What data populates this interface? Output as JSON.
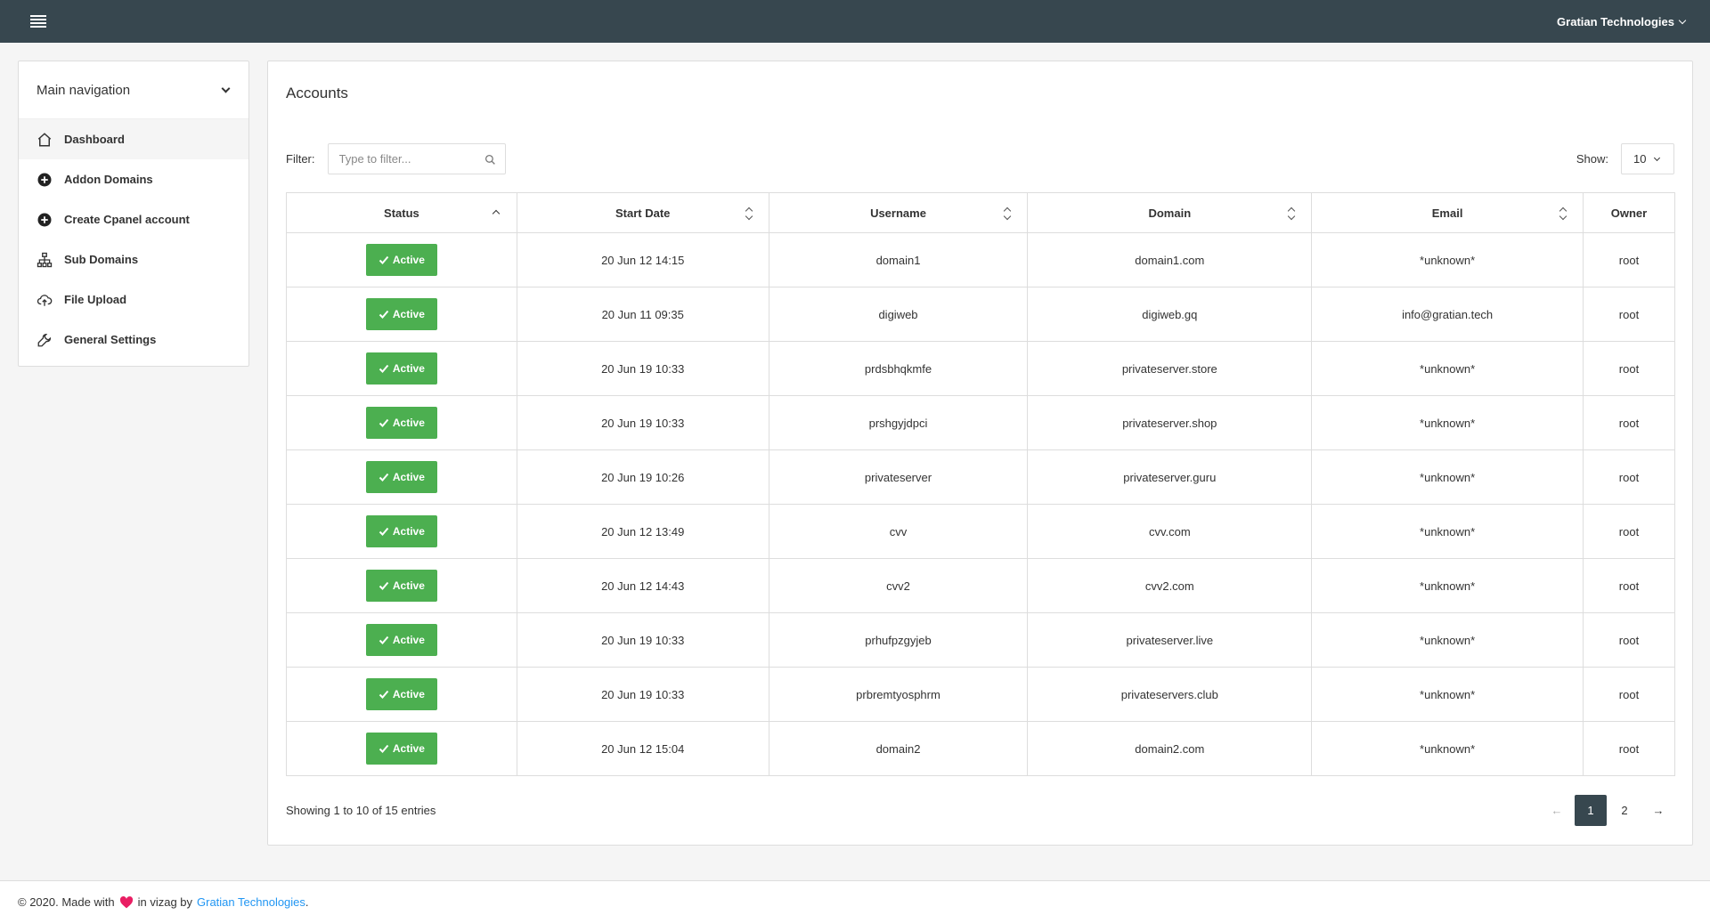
{
  "header": {
    "org": "Gratian Technologies"
  },
  "sidebar": {
    "title": "Main navigation",
    "items": [
      {
        "label": "Dashboard",
        "icon": "home-icon"
      },
      {
        "label": "Addon Domains",
        "icon": "plus-circle-icon"
      },
      {
        "label": "Create Cpanel account",
        "icon": "plus-circle-icon"
      },
      {
        "label": "Sub Domains",
        "icon": "sitemap-icon"
      },
      {
        "label": "File Upload",
        "icon": "cloud-upload-icon"
      },
      {
        "label": "General Settings",
        "icon": "wrench-icon"
      }
    ]
  },
  "main": {
    "title": "Accounts",
    "filter_label": "Filter:",
    "filter_placeholder": "Type to filter...",
    "show_label": "Show:",
    "show_value": "10",
    "columns": [
      "Status",
      "Start Date",
      "Username",
      "Domain",
      "Email",
      "Owner"
    ],
    "rows": [
      {
        "status": "Active",
        "start": "20 Jun 12 14:15",
        "username": "domain1",
        "domain": "domain1.com",
        "email": "*unknown*",
        "owner": "root"
      },
      {
        "status": "Active",
        "start": "20 Jun 11 09:35",
        "username": "digiweb",
        "domain": "digiweb.gq",
        "email": "info@gratian.tech",
        "owner": "root"
      },
      {
        "status": "Active",
        "start": "20 Jun 19 10:33",
        "username": "prdsbhqkmfe",
        "domain": "privateserver.store",
        "email": "*unknown*",
        "owner": "root"
      },
      {
        "status": "Active",
        "start": "20 Jun 19 10:33",
        "username": "prshgyjdpci",
        "domain": "privateserver.shop",
        "email": "*unknown*",
        "owner": "root"
      },
      {
        "status": "Active",
        "start": "20 Jun 19 10:26",
        "username": "privateserver",
        "domain": "privateserver.guru",
        "email": "*unknown*",
        "owner": "root"
      },
      {
        "status": "Active",
        "start": "20 Jun 12 13:49",
        "username": "cvv",
        "domain": "cvv.com",
        "email": "*unknown*",
        "owner": "root"
      },
      {
        "status": "Active",
        "start": "20 Jun 12 14:43",
        "username": "cvv2",
        "domain": "cvv2.com",
        "email": "*unknown*",
        "owner": "root"
      },
      {
        "status": "Active",
        "start": "20 Jun 19 10:33",
        "username": "prhufpzgyjeb",
        "domain": "privateserver.live",
        "email": "*unknown*",
        "owner": "root"
      },
      {
        "status": "Active",
        "start": "20 Jun 19 10:33",
        "username": "prbremtyosphrm",
        "domain": "privateservers.club",
        "email": "*unknown*",
        "owner": "root"
      },
      {
        "status": "Active",
        "start": "20 Jun 12 15:04",
        "username": "domain2",
        "domain": "domain2.com",
        "email": "*unknown*",
        "owner": "root"
      }
    ],
    "entries_text": "Showing 1 to 10 of 15 entries",
    "pagination": {
      "prev": "←",
      "pages": [
        "1",
        "2"
      ],
      "current": "1",
      "next": "→"
    }
  },
  "footer": {
    "prefix": "© 2020. Made with",
    "middle": "in vizag by",
    "link": "Gratian Technologies",
    "suffix": "."
  },
  "colors": {
    "topbar": "#37474f",
    "active": "#4caf50",
    "link": "#2196f3",
    "heart": "#e91e63"
  }
}
